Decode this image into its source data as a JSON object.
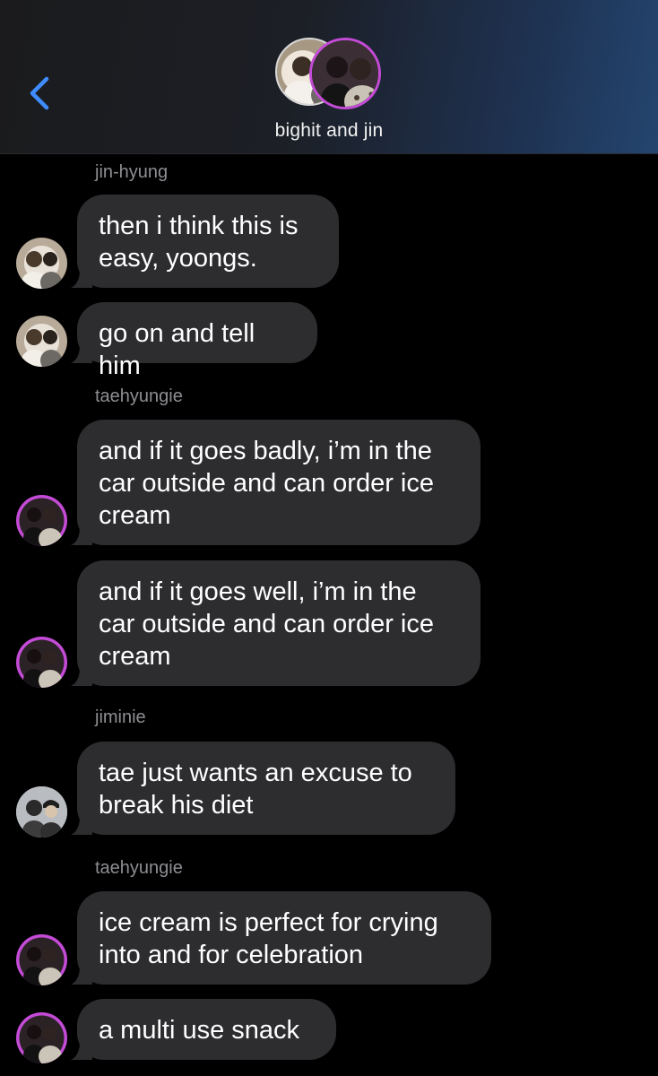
{
  "header": {
    "back_icon": "chevron-left-icon",
    "group_name": "bighit and jin",
    "accent_color": "#3f8cff"
  },
  "messages": [
    {
      "sender": "jin-hyung",
      "text": "then i think this is easy, yoongs.",
      "lines": [
        "then i think this is",
        "easy, yoongs."
      ]
    },
    {
      "sender": "jin-hyung",
      "text": "go on and tell him",
      "lines": [
        "go on and tell him"
      ]
    },
    {
      "sender": "taehyungie",
      "text": "and if it goes badly, i’m in the car outside and can order ice cream",
      "lines": [
        "and if it goes badly, i’m in the",
        "car outside and can order ice",
        "cream"
      ]
    },
    {
      "sender": "taehyungie",
      "text": "and if it goes well, i’m in the car outside and can order ice cream",
      "lines": [
        "and if it goes well, i’m in the",
        "car outside and can order ice",
        "cream"
      ]
    },
    {
      "sender": "jiminie",
      "text": "tae just wants an excuse to break his diet",
      "lines": [
        "tae just wants an excuse to",
        "break his diet"
      ]
    },
    {
      "sender": "taehyungie",
      "text": "ice cream is perfect for crying into and for celebration",
      "lines": [
        "ice cream is perfect for crying",
        "into and for celebration"
      ]
    },
    {
      "sender": "taehyungie",
      "text": "a multi use snack",
      "lines": [
        "a multi use snack"
      ]
    }
  ],
  "colors": {
    "background": "#000000",
    "bubble": "#2d2d30",
    "sender_label": "#8e8e93"
  }
}
